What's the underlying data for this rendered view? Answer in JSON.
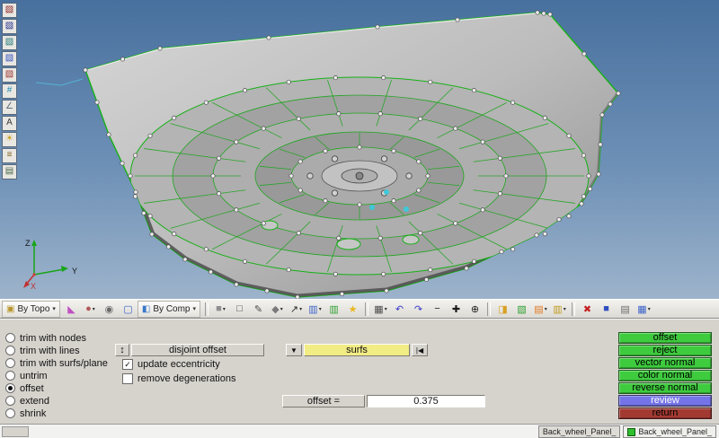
{
  "viewport": {
    "axis_labels": {
      "x": "X",
      "y": "Y",
      "z": "Z"
    },
    "gradient_top": "#48709e",
    "gradient_bottom": "#9db3cb"
  },
  "left_toolbar": {
    "icons": [
      {
        "name": "doc-red",
        "glyph": "▧",
        "color": "#8b1e1e"
      },
      {
        "name": "doc-navy",
        "glyph": "▧",
        "color": "#20308f"
      },
      {
        "name": "doc-teal",
        "glyph": "▧",
        "color": "#1e7a7a"
      },
      {
        "name": "doc-blue",
        "glyph": "▧",
        "color": "#2f50bf"
      },
      {
        "name": "doc-maroon",
        "glyph": "▧",
        "color": "#9a3030"
      },
      {
        "name": "numbers-123",
        "glyph": "#",
        "color": "#2090b0"
      },
      {
        "name": "measure-angle",
        "glyph": "∠",
        "color": "#607080"
      },
      {
        "name": "abc-text",
        "glyph": "A",
        "color": "#3a3a3a"
      },
      {
        "name": "lightbulb",
        "glyph": "☀",
        "color": "#c8a020"
      },
      {
        "name": "layers-stack",
        "glyph": "≡",
        "color": "#806020"
      },
      {
        "name": "clipboard",
        "glyph": "▤",
        "color": "#4a6a4a"
      }
    ]
  },
  "toolbar": {
    "items": [
      {
        "type": "dropdown",
        "name": "by-topo",
        "label": "By Topo",
        "glyph": "▣",
        "color": "#b8952e"
      },
      {
        "type": "icon",
        "name": "view-cone",
        "glyph": "◣",
        "color": "#c050c0"
      },
      {
        "type": "icon",
        "name": "shaded-sphere",
        "glyph": "●",
        "color": "#b05858",
        "arrow": true
      },
      {
        "type": "icon",
        "name": "wireframe-sphere",
        "glyph": "◉",
        "color": "#6a6a6a"
      },
      {
        "type": "icon",
        "name": "display-monitor",
        "glyph": "▢",
        "color": "#3a62c8"
      },
      {
        "type": "dropdown",
        "name": "by-comp",
        "label": "By Comp",
        "glyph": "◧",
        "color": "#3a78c8"
      },
      {
        "type": "sep"
      },
      {
        "type": "icon",
        "name": "solid-cube",
        "glyph": "■",
        "color": "#8f8f8f",
        "arrow": true
      },
      {
        "type": "icon",
        "name": "wire-cube",
        "glyph": "□",
        "color": "#4a4a4a"
      },
      {
        "type": "icon",
        "name": "draw-line",
        "glyph": "✎",
        "color": "#4a4a4a"
      },
      {
        "type": "icon",
        "name": "diamond-tool",
        "glyph": "◆",
        "color": "#7a7a7a",
        "arrow": true
      },
      {
        "type": "icon",
        "name": "vector-tool",
        "glyph": "↗",
        "color": "#2a2a2a",
        "arrow": true
      },
      {
        "type": "icon",
        "name": "screen-blue",
        "glyph": "▥",
        "color": "#3a62c8",
        "arrow": true
      },
      {
        "type": "icon",
        "name": "screen-green",
        "glyph": "▥",
        "color": "#2f9f2f"
      },
      {
        "type": "icon",
        "name": "favorites-star",
        "glyph": "★",
        "color": "#e8b820"
      },
      {
        "type": "sep"
      },
      {
        "type": "icon",
        "name": "mesh-grid",
        "glyph": "▦",
        "color": "#4a4a4a",
        "arrow": true
      },
      {
        "type": "icon",
        "name": "undo-arrow",
        "glyph": "↶",
        "color": "#3a3ac8"
      },
      {
        "type": "icon",
        "name": "redo-arrow",
        "glyph": "↷",
        "color": "#3a3ac8"
      },
      {
        "type": "icon",
        "name": "zoom-out",
        "glyph": "−",
        "color": "#1a1a1a"
      },
      {
        "type": "icon",
        "name": "zoom-in",
        "glyph": "✚",
        "color": "#1a1a1a"
      },
      {
        "type": "icon",
        "name": "fit-target",
        "glyph": "⊕",
        "color": "#1a1a1a"
      },
      {
        "type": "sep"
      },
      {
        "type": "icon",
        "name": "mask-yellow",
        "glyph": "◨",
        "color": "#d8a020"
      },
      {
        "type": "icon",
        "name": "mask-green",
        "glyph": "▧",
        "color": "#2f9f2f"
      },
      {
        "type": "icon",
        "name": "mask-orange",
        "glyph": "▤",
        "color": "#e07820",
        "arrow": true
      },
      {
        "type": "icon",
        "name": "mask-gold",
        "glyph": "▥",
        "color": "#c09a20",
        "arrow": true
      },
      {
        "type": "sep"
      },
      {
        "type": "icon",
        "name": "delete-cross",
        "glyph": "✖",
        "color": "#c42020"
      },
      {
        "type": "icon",
        "name": "entity-blue",
        "glyph": "■",
        "color": "#3050c0"
      },
      {
        "type": "icon",
        "name": "note-card",
        "glyph": "▤",
        "color": "#6a6a6a"
      },
      {
        "type": "icon",
        "name": "snap-grid",
        "glyph": "▦",
        "color": "#3a62c8",
        "arrow": true
      }
    ]
  },
  "panel": {
    "radios": [
      {
        "label": "trim with nodes",
        "selected": false
      },
      {
        "label": "trim with lines",
        "selected": false
      },
      {
        "label": "trim with surfs/plane",
        "selected": false
      },
      {
        "label": "untrim",
        "selected": false
      },
      {
        "label": "offset",
        "selected": true
      },
      {
        "label": "extend",
        "selected": false
      },
      {
        "label": "shrink",
        "selected": false
      }
    ],
    "spinner_icon": "↕",
    "mode_button": "disjoint offset",
    "dropdown_icon": "▼",
    "selector": {
      "label": "surfs",
      "bg": "#f2ec85",
      "reset_icon": "|◀"
    },
    "check_glyph": "✓",
    "checkboxes": [
      {
        "label": "update eccentricity",
        "checked": true
      },
      {
        "label": "remove degenerations",
        "checked": false
      }
    ],
    "offset_label": "offset =",
    "offset_value": "0.375",
    "action_buttons": [
      {
        "label": "offset",
        "bg": "#3ecb3e",
        "fg": "#000000"
      },
      {
        "label": "reject",
        "bg": "#3ecb3e",
        "fg": "#000000"
      },
      {
        "label": "vector normal",
        "bg": "#3ecb3e",
        "fg": "#000000"
      },
      {
        "label": "color normal",
        "bg": "#3ecb3e",
        "fg": "#000000"
      },
      {
        "label": "reverse normal",
        "bg": "#3ecb3e",
        "fg": "#000000"
      },
      {
        "label": "review",
        "bg": "#7474e8",
        "fg": "#ffffff"
      },
      {
        "label": "return",
        "bg": "#a23a32",
        "fg": "#000000"
      }
    ]
  },
  "statusbar": {
    "tabs": [
      {
        "label": "Back_wheel_Panel_",
        "icon": false
      },
      {
        "label": "Back_wheel_Panel_",
        "icon": true,
        "icon_color": "#2fbf2f"
      }
    ]
  }
}
